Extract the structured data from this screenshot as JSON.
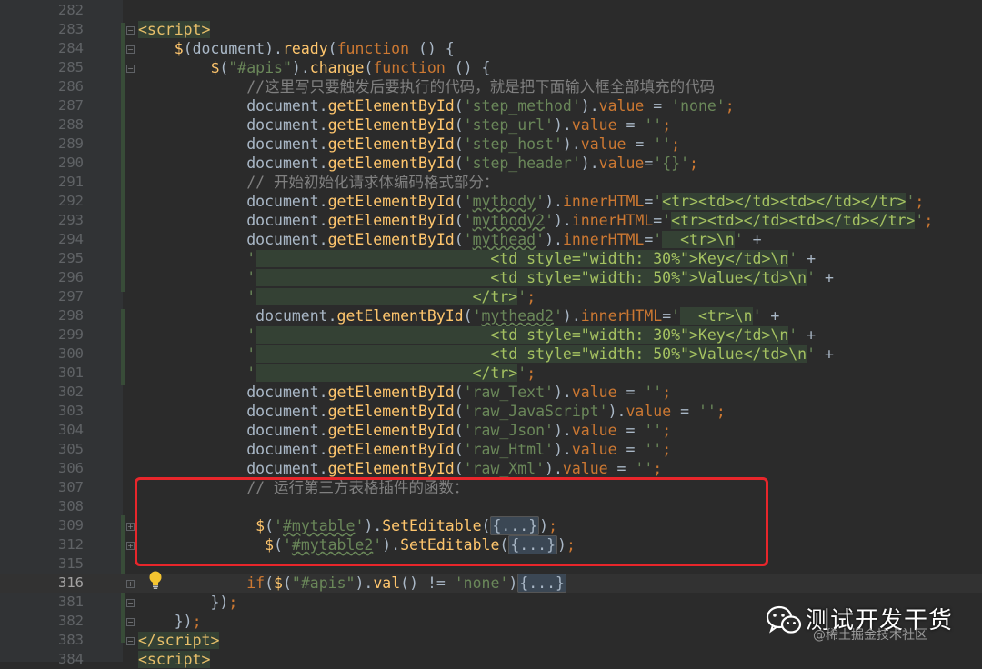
{
  "editor": {
    "current_line": "316",
    "lines": [
      {
        "no": "282",
        "html": ""
      },
      {
        "no": "283",
        "html": "<span class=\"tag\">&lt;script&gt;</span>"
      },
      {
        "no": "284",
        "html": "    <span class=\"fn\">$</span>(document).<span class=\"fn\">ready</span>(<span class=\"kw\">function</span> () {"
      },
      {
        "no": "285",
        "html": "        <span class=\"fn\">$</span>(<span class=\"str\">\"#apis\"</span>).<span class=\"fn\">change</span>(<span class=\"kw\">function</span> () {"
      },
      {
        "no": "286",
        "html": "            <span class=\"cm\">//这里写只要触发后要执行的代码，就是把下面输入框全部填充的代码</span>"
      },
      {
        "no": "287",
        "html": "            document.<span class=\"fn\">getElementById</span>(<span class=\"str\">'step_method'</span>).<span class=\"kw\">value</span> = <span class=\"str\">'none'</span><span class=\"kw\">;</span>"
      },
      {
        "no": "288",
        "html": "            document.<span class=\"fn\">getElementById</span>(<span class=\"str\">'step_url'</span>).<span class=\"kw\">value</span> = <span class=\"str\">''</span><span class=\"kw\">;</span>"
      },
      {
        "no": "289",
        "html": "            document.<span class=\"fn\">getElementById</span>(<span class=\"str\">'step_host'</span>).<span class=\"kw\">value</span> = <span class=\"str\">''</span><span class=\"kw\">;</span>"
      },
      {
        "no": "290",
        "html": "            document.<span class=\"fn\">getElementById</span>(<span class=\"str\">'step_header'</span>).<span class=\"kw\">value</span>=<span class=\"str\">'{}'</span><span class=\"kw\">;</span>"
      },
      {
        "no": "291",
        "html": "            <span class=\"cm\">// 开始初始化请求体编码格式部分：</span>"
      },
      {
        "no": "292",
        "html": "            document.<span class=\"fn\">getElementById</span>(<span class=\"str\">'<span class=\"wavy\">mytbody</span>'</span>).<span class=\"kw\">innerHTML</span>=<span class=\"str\">'<span class=\"strhi\">&lt;tr&gt;&lt;td&gt;&lt;/td&gt;&lt;td&gt;&lt;/td&gt;&lt;/tr&gt;</span>'</span><span class=\"kw\">;</span>"
      },
      {
        "no": "293",
        "html": "            document.<span class=\"fn\">getElementById</span>(<span class=\"str\">'<span class=\"wavy\">mytbody2</span>'</span>).<span class=\"kw\">innerHTML</span>=<span class=\"str\">'<span class=\"strhi\">&lt;tr&gt;&lt;td&gt;&lt;/td&gt;&lt;td&gt;&lt;/td&gt;&lt;/tr&gt;</span>'</span><span class=\"kw\">;</span>"
      },
      {
        "no": "294",
        "html": "            document.<span class=\"fn\">getElementById</span>(<span class=\"str\">'<span class=\"wavy\">mythead</span>'</span>).<span class=\"kw\">innerHTML</span>=<span class=\"str\">'<span class=\"strhi\">  &lt;tr&gt;\\n</span>'</span> +"
      },
      {
        "no": "295",
        "html": "            <span class=\"str\">'<span class=\"strhi\">                          &lt;td style=\"width: 30%\"&gt;Key&lt;/td&gt;\\n</span>'</span> +"
      },
      {
        "no": "296",
        "html": "            <span class=\"str\">'<span class=\"strhi\">                          &lt;td style=\"width: 50%\"&gt;Value&lt;/td&gt;\\n</span>'</span> +"
      },
      {
        "no": "297",
        "html": "            <span class=\"str\">'<span class=\"strhi\">                        &lt;/tr&gt;</span>'</span><span class=\"kw\">;</span>"
      },
      {
        "no": "298",
        "html": "             document.<span class=\"fn\">getElementById</span>(<span class=\"str\">'<span class=\"wavy\">mythead2</span>'</span>).<span class=\"kw\">innerHTML</span>=<span class=\"str\">'<span class=\"strhi\">  &lt;tr&gt;\\n</span>'</span> +"
      },
      {
        "no": "299",
        "html": "            <span class=\"str\">'<span class=\"strhi\">                          &lt;td style=\"width: 30%\"&gt;Key&lt;/td&gt;\\n</span>'</span> +"
      },
      {
        "no": "300",
        "html": "            <span class=\"str\">'<span class=\"strhi\">                          &lt;td style=\"width: 50%\"&gt;Value&lt;/td&gt;\\n</span>'</span> +"
      },
      {
        "no": "301",
        "html": "            <span class=\"str\">'<span class=\"strhi\">                        &lt;/tr&gt;</span>'</span><span class=\"kw\">;</span>"
      },
      {
        "no": "302",
        "html": "            document.<span class=\"fn\">getElementById</span>(<span class=\"str\">'raw_Text'</span>).<span class=\"kw\">value</span> = <span class=\"str\">''</span><span class=\"kw\">;</span>"
      },
      {
        "no": "303",
        "html": "            document.<span class=\"fn\">getElementById</span>(<span class=\"str\">'raw_JavaScript'</span>).<span class=\"kw\">value</span> = <span class=\"str\">''</span><span class=\"kw\">;</span>"
      },
      {
        "no": "304",
        "html": "            document.<span class=\"fn\">getElementById</span>(<span class=\"str\">'raw_Json'</span>).<span class=\"kw\">value</span> = <span class=\"str\">''</span><span class=\"kw\">;</span>"
      },
      {
        "no": "305",
        "html": "            document.<span class=\"fn\">getElementById</span>(<span class=\"str\">'raw_Html'</span>).<span class=\"kw\">value</span> = <span class=\"str\">''</span><span class=\"kw\">;</span>"
      },
      {
        "no": "306",
        "html": "            document.<span class=\"fn\">getElementById</span>(<span class=\"str\">'raw_Xml'</span>).<span class=\"kw\">value</span> = <span class=\"str\">''</span><span class=\"kw\">;</span>"
      },
      {
        "no": "307",
        "html": "            <span class=\"cm\">// 运行第三方表格插件的函数：</span>"
      },
      {
        "no": "308",
        "html": ""
      },
      {
        "no": "309",
        "html": "             <span class=\"fn\">$</span>(<span class=\"str\">'<span class=\"wavy\">#mytable</span>'</span>).<span class=\"fn\">SetEditable</span>(<span class=\"fold-block\">{...}</span>)<span class=\"kw\">;</span>"
      },
      {
        "no": "312",
        "html": "              <span class=\"fn\">$</span>(<span class=\"str\">'<span class=\"wavy\">#mytable2</span>'</span>).<span class=\"fn\">SetEditable</span>(<span class=\"fold-block\">{...}</span>)<span class=\"kw\">;</span>"
      },
      {
        "no": "315",
        "html": ""
      },
      {
        "no": "316",
        "html": "            <span class=\"kw\">if</span>(<span class=\"fn\">$</span>(<span class=\"str\">\"#apis\"</span>).<span class=\"fn\">val</span>() != <span class=\"str\">'none'</span>)<span class=\"fold-block\">{...}</span>"
      },
      {
        "no": "381",
        "html": "        })<span class=\"kw\">;</span>"
      },
      {
        "no": "382",
        "html": "    })<span class=\"kw\">;</span>"
      },
      {
        "no": "383",
        "html": "<span class=\"tag\">&lt;/script&gt;</span>"
      },
      {
        "no": "384",
        "html": "<span class=\"tag\">&lt;script&gt;</span>"
      }
    ]
  },
  "watermark": {
    "title": "测试开发干货",
    "credit": "@稀土掘金技术社区"
  },
  "colors": {
    "background": "#2b2b2b",
    "gutter": "#313335",
    "keyword": "#cc7832",
    "function": "#ffc66d",
    "string": "#6a8759",
    "comment": "#808080",
    "highlight_box": "#e8262b"
  },
  "icons": [
    "lightbulb-icon",
    "fold-icon",
    "wechat-icon"
  ]
}
